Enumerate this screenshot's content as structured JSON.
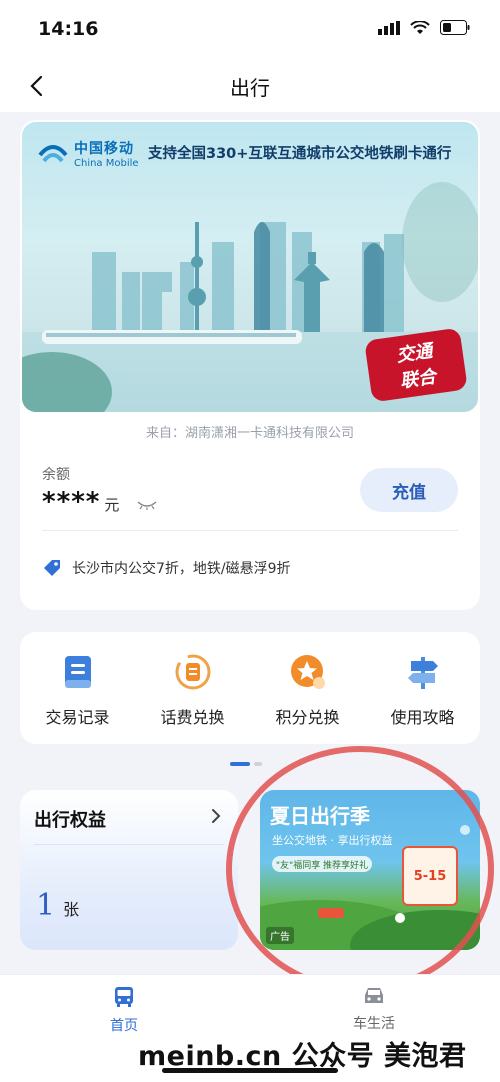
{
  "status_bar": {
    "time": "14:16"
  },
  "nav": {
    "title": "出行"
  },
  "card": {
    "brand_cn": "中国移动",
    "brand_en": "China Mobile",
    "slogan": "支持全国330+互联互通城市公交地铁刷卡通行",
    "tunion_top": "交通",
    "tunion_bottom": "联合",
    "source": "来自：湖南潇湘一卡通科技有限公司",
    "balance_label": "余额",
    "balance_masked": "****",
    "balance_unit": "元",
    "recharge_label": "充值",
    "discount_text": "长沙市内公交7折，地铁/磁悬浮9折"
  },
  "quick_actions": [
    {
      "label": "交易记录",
      "icon": "record-book-icon"
    },
    {
      "label": "话费兑换",
      "icon": "phone-bill-exchange-icon"
    },
    {
      "label": "积分兑换",
      "icon": "points-star-icon"
    },
    {
      "label": "使用攻略",
      "icon": "signpost-icon"
    }
  ],
  "benefits": {
    "title": "出行权益",
    "count": "1",
    "unit": "张"
  },
  "ad": {
    "title": "夏日出行季",
    "subtitle": "坐公交地铁 · 享出行权益",
    "pill": "\"友\"福同享 推荐享好礼",
    "coupon": "5-15",
    "tag": "广告"
  },
  "tabs": [
    {
      "label": "首页",
      "active": true
    },
    {
      "label": "车生活",
      "active": false
    }
  ],
  "watermark": "meinb.cn 公众号 美泡君",
  "colors": {
    "accent": "#2f6fd6",
    "highlight": "#e25050",
    "tunion_red": "#c8142b"
  }
}
